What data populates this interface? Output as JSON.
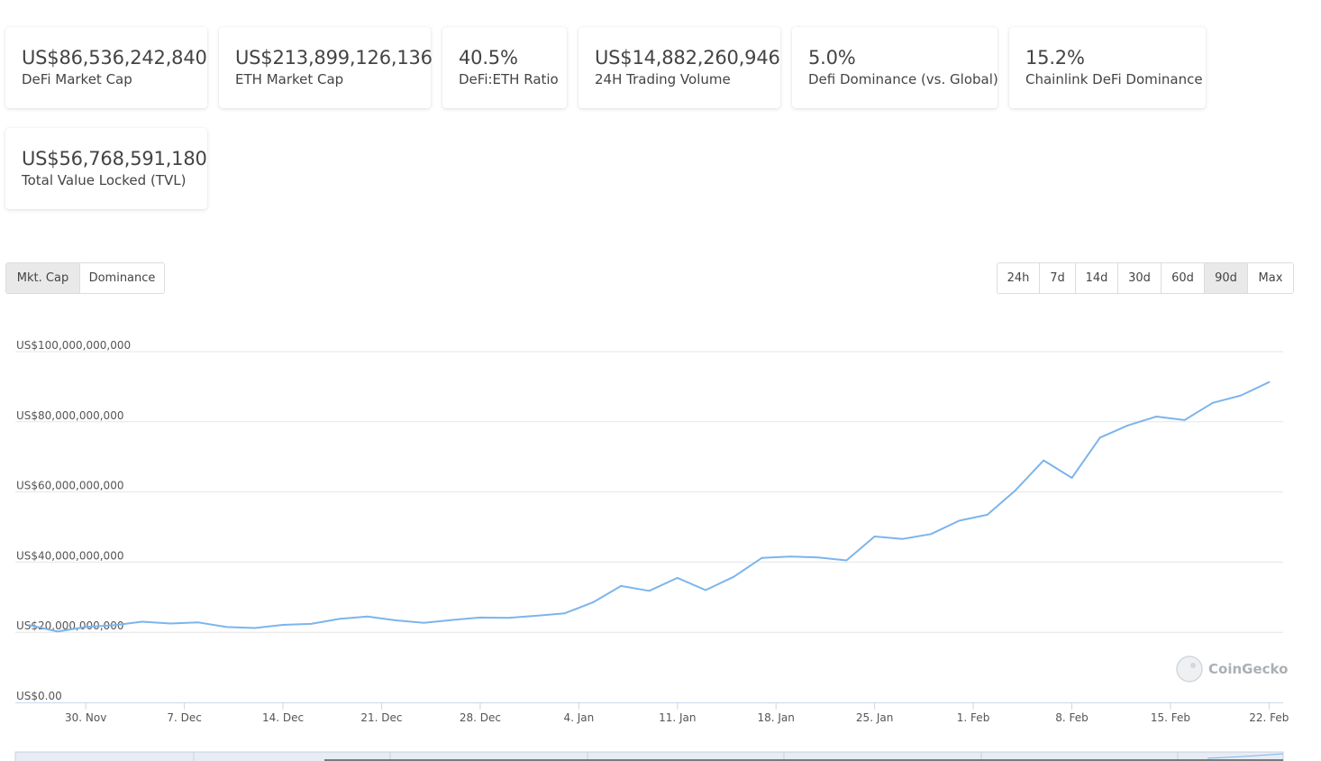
{
  "stats": [
    {
      "value": "US$86,536,242,840",
      "label": "DeFi Market Cap"
    },
    {
      "value": "US$213,899,126,136",
      "label": "ETH Market Cap"
    },
    {
      "value": "40.5%",
      "label": "DeFi:ETH Ratio"
    },
    {
      "value": "US$14,882,260,946",
      "label": "24H Trading Volume"
    },
    {
      "value": "5.0%",
      "label": "Defi Dominance (vs. Global)"
    },
    {
      "value": "15.2%",
      "label": "Chainlink DeFi Dominance"
    },
    {
      "value": "US$56,768,591,180",
      "label": "Total Value Locked (TVL)"
    }
  ],
  "chart_tabs": {
    "items": [
      "Mkt. Cap",
      "Dominance"
    ],
    "active": "Mkt. Cap"
  },
  "ranges": {
    "items": [
      "24h",
      "7d",
      "14d",
      "30d",
      "60d",
      "90d",
      "Max"
    ],
    "active": "90d"
  },
  "watermark": "CoinGecko",
  "colors": {
    "line": "#7cb5ec",
    "grid": "#e6e6e6",
    "active_button": "#e9e9e9"
  },
  "chart_data": {
    "type": "line",
    "title": "",
    "xlabel": "",
    "ylabel": "",
    "ylim": [
      0,
      100000000000
    ],
    "yticks": [
      0,
      20000000000,
      40000000000,
      60000000000,
      80000000000,
      100000000000
    ],
    "ytick_labels": [
      "US$0.00",
      "US$20,000,000,000",
      "US$40,000,000,000",
      "US$60,000,000,000",
      "US$80,000,000,000",
      "US$100,000,000,000"
    ],
    "x_range": [
      "2020-11-25",
      "2021-02-23"
    ],
    "xticks": [
      "2020-11-30",
      "2020-12-07",
      "2020-12-14",
      "2020-12-21",
      "2020-12-28",
      "2021-01-04",
      "2021-01-11",
      "2021-01-18",
      "2021-01-25",
      "2021-02-01",
      "2021-02-08",
      "2021-02-15",
      "2021-02-22"
    ],
    "xtick_labels": [
      "30. Nov",
      "7. Dec",
      "14. Dec",
      "21. Dec",
      "28. Dec",
      "4. Jan",
      "11. Jan",
      "18. Jan",
      "25. Jan",
      "1. Feb",
      "8. Feb",
      "15. Feb",
      "22. Feb"
    ],
    "grid": true,
    "legend": "none",
    "series": [
      {
        "x": [
          "2020-11-26",
          "2020-11-28",
          "2020-11-30",
          "2020-12-02",
          "2020-12-04",
          "2020-12-06",
          "2020-12-08",
          "2020-12-10",
          "2020-12-12",
          "2020-12-14",
          "2020-12-16",
          "2020-12-18",
          "2020-12-20",
          "2020-12-22",
          "2020-12-24",
          "2020-12-26",
          "2020-12-28",
          "2020-12-30",
          "2021-01-01",
          "2021-01-03",
          "2021-01-05",
          "2021-01-07",
          "2021-01-09",
          "2021-01-11",
          "2021-01-13",
          "2021-01-15",
          "2021-01-17",
          "2021-01-19",
          "2021-01-21",
          "2021-01-23",
          "2021-01-25",
          "2021-01-27",
          "2021-01-29",
          "2021-01-31",
          "2021-02-02",
          "2021-02-04",
          "2021-02-06",
          "2021-02-08",
          "2021-02-10",
          "2021-02-12",
          "2021-02-14",
          "2021-02-16",
          "2021-02-18",
          "2021-02-20",
          "2021-02-22"
        ],
        "values": [
          22000000000,
          20200000000,
          21500000000,
          22000000000,
          23000000000,
          22500000000,
          22800000000,
          21500000000,
          21200000000,
          22100000000,
          22400000000,
          23800000000,
          24500000000,
          23400000000,
          22700000000,
          23500000000,
          24200000000,
          24100000000,
          24700000000,
          25400000000,
          28500000000,
          33200000000,
          31800000000,
          35500000000,
          32000000000,
          35800000000,
          41200000000,
          41600000000,
          41300000000,
          40500000000,
          47300000000,
          46600000000,
          48000000000,
          51800000000,
          53500000000,
          60500000000,
          69000000000,
          64000000000,
          75500000000,
          79000000000,
          81500000000,
          80500000000,
          85400000000,
          87500000000,
          91300000000
        ]
      }
    ]
  }
}
